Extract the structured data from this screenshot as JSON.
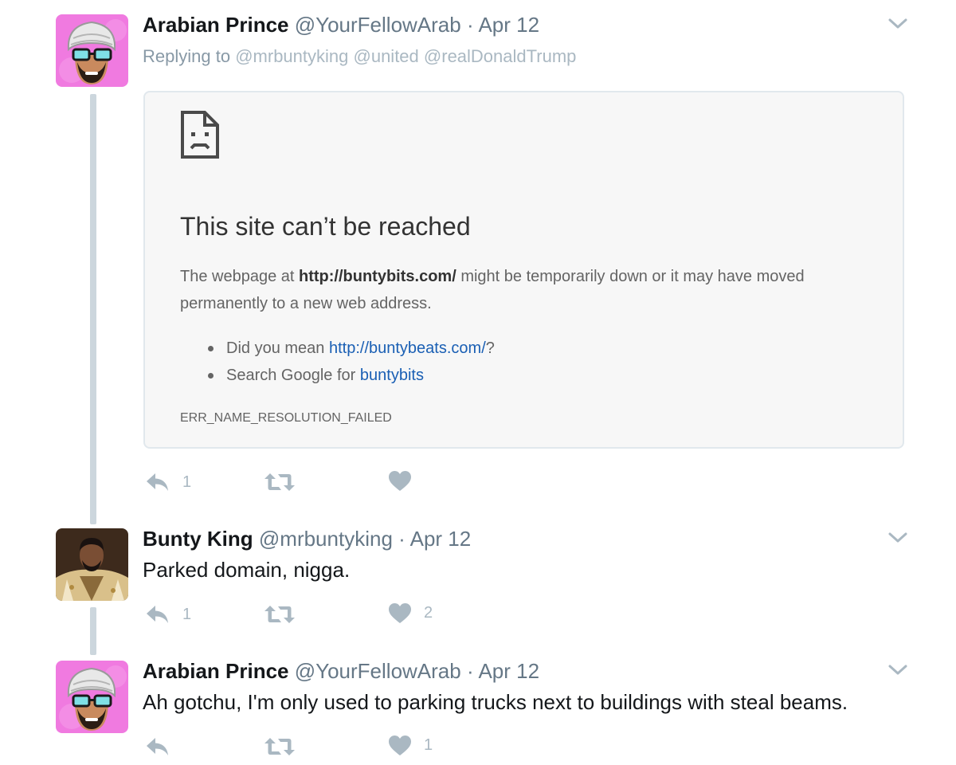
{
  "tweets": [
    {
      "name": "Arabian Prince",
      "handle": "@YourFellowArab",
      "separator": "·",
      "date": "Apr 12",
      "replying_to_label": "Replying to",
      "mentions": [
        "@mrbuntyking",
        "@united",
        "@realDonaldTrump"
      ],
      "reply_count": "1",
      "retweet_count": "",
      "like_count": ""
    },
    {
      "name": "Bunty King",
      "handle": "@mrbuntyking",
      "separator": "·",
      "date": "Apr 12",
      "text": "Parked domain, nigga.",
      "reply_count": "1",
      "retweet_count": "",
      "like_count": "2"
    },
    {
      "name": "Arabian Prince",
      "handle": "@YourFellowArab",
      "separator": "·",
      "date": "Apr 12",
      "text": "Ah gotchu, I'm only used to parking trucks next to buildings with steal beams.",
      "reply_count": "",
      "retweet_count": "",
      "like_count": "1"
    }
  ],
  "error_card": {
    "title": "This site can’t be reached",
    "body_prefix": "The webpage at",
    "url": "http://buntybits.com/",
    "body_suffix": "might be temporarily down or it may have moved permanently to a new web address.",
    "suggestion_1_prefix": "Did you mean",
    "suggestion_1_link": "http://buntybeats.com/",
    "suggestion_1_suffix": "?",
    "suggestion_2_prefix": "Search Google for",
    "suggestion_2_link": "buntybits",
    "error_code": "ERR_NAME_RESOLUTION_FAILED"
  },
  "icons": {
    "reply": "reply-icon",
    "retweet": "retweet-icon",
    "like": "heart-icon",
    "more": "chevron-down-icon",
    "error_page": "sad-document-icon"
  },
  "colors": {
    "text_primary": "#14171a",
    "text_secondary": "#657786",
    "action_gray": "#aab8c2",
    "thread_line": "#ccd6dd",
    "card_background": "#f7f7f7",
    "link_blue": "#1a5fb4",
    "avatar_pink": "#f07ae0"
  }
}
